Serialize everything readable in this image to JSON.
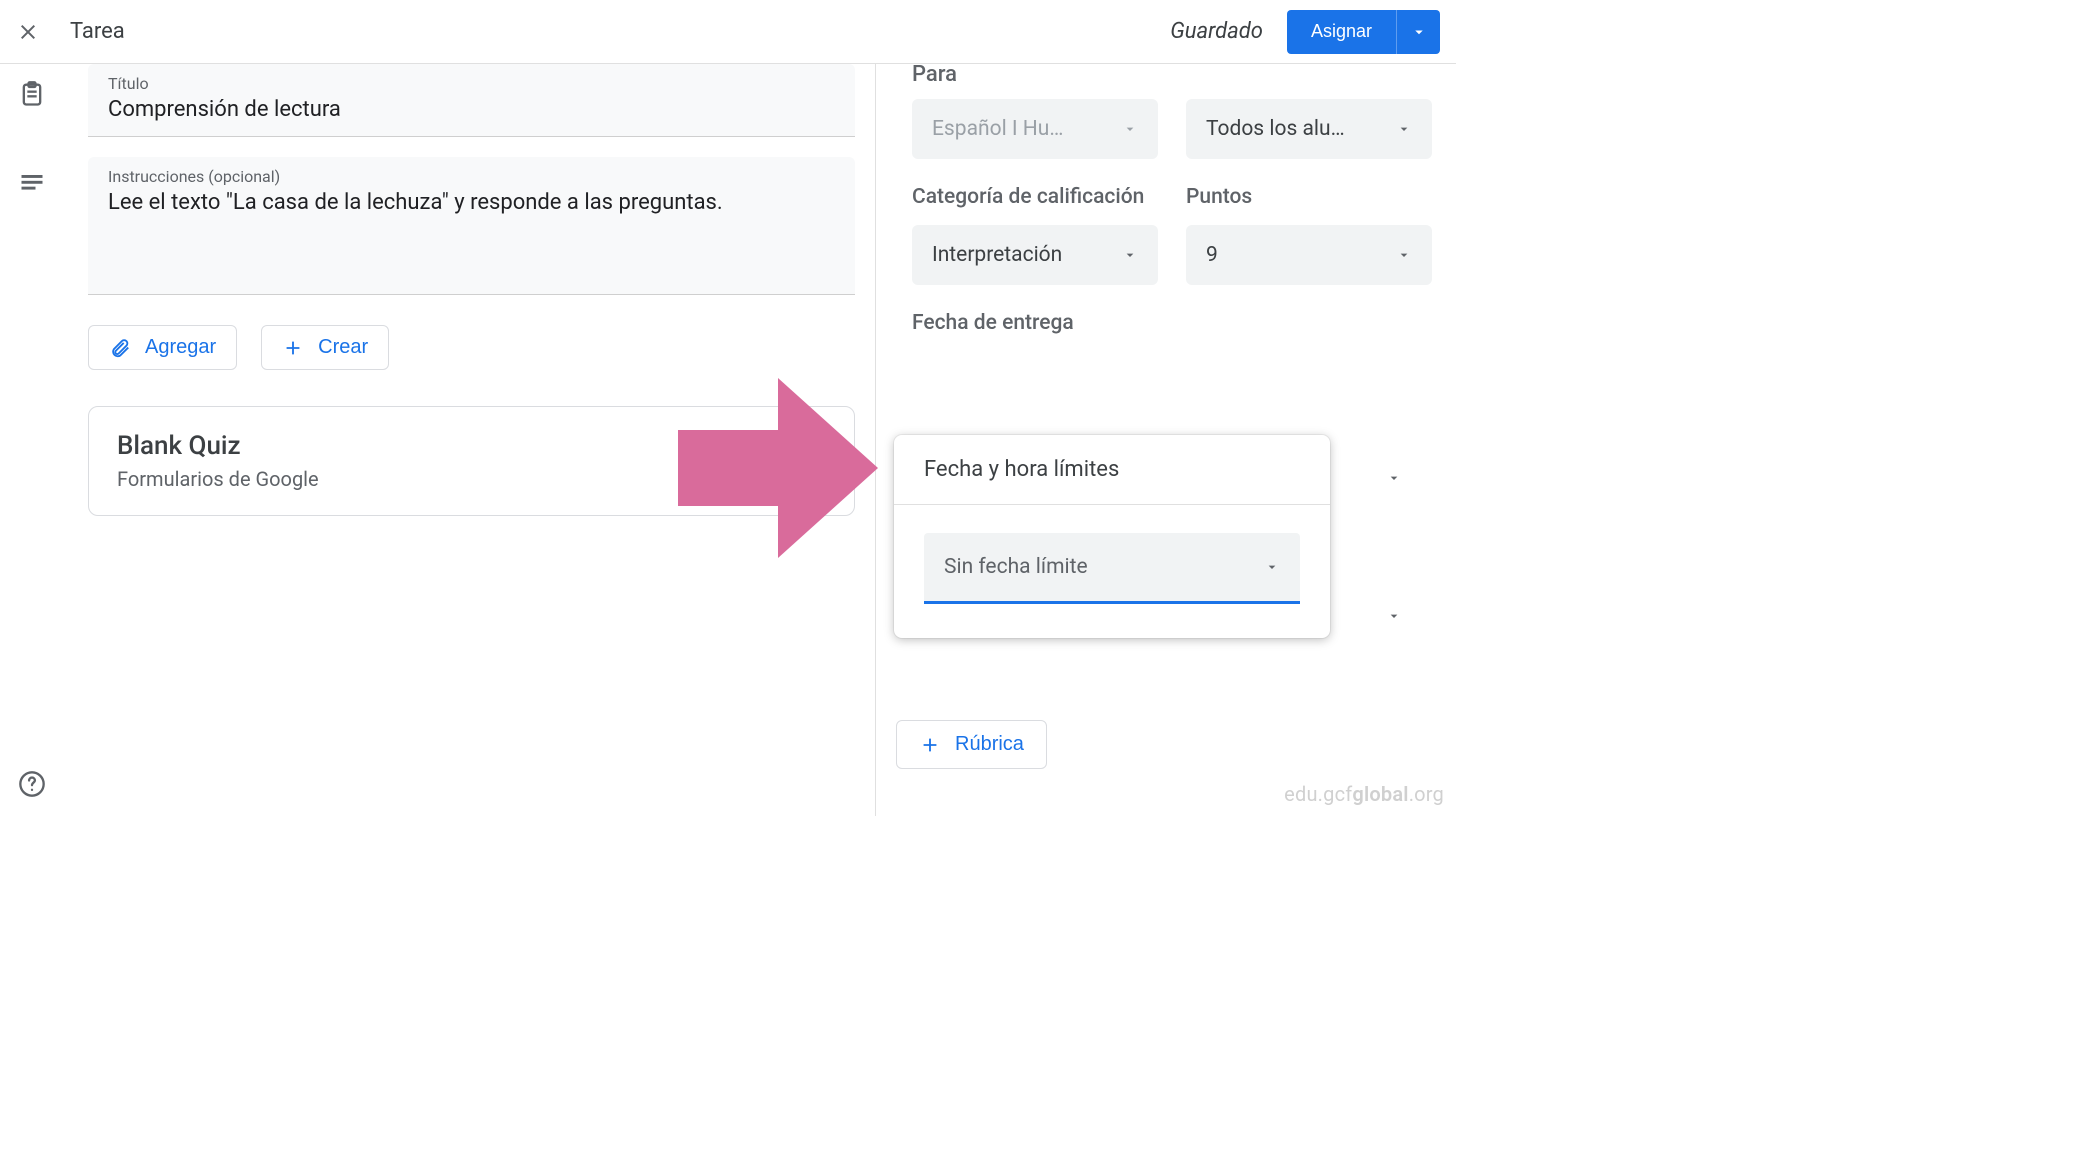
{
  "header": {
    "title": "Tarea",
    "saved_status": "Guardado",
    "assign_label": "Asignar"
  },
  "main": {
    "title_label": "Título",
    "title_value": "Comprensión de lectura",
    "instructions_label": "Instrucciones (opcional)",
    "instructions_value": "Lee el texto \"La casa de la lechuza\" y responde a las preguntas.",
    "add_btn": "Agregar",
    "create_btn": "Crear",
    "attachment": {
      "title": "Blank Quiz",
      "subtitle": "Formularios de Google"
    }
  },
  "side": {
    "para_label": "Para",
    "class_value": "Español I Hu…",
    "students_value": "Todos los alu…",
    "grade_category_label": "Categoría de calificación",
    "grade_category_value": "Interpretación",
    "points_label": "Puntos",
    "points_value": "9",
    "due_label": "Fecha de entrega",
    "popup_title": "Fecha y hora límites",
    "popup_dd_value": "Sin fecha límite",
    "rubric_btn": "Rúbrica"
  },
  "footer": {
    "watermark_left": "edu.gcf",
    "watermark_mid": "global",
    "watermark_right": ".org"
  }
}
